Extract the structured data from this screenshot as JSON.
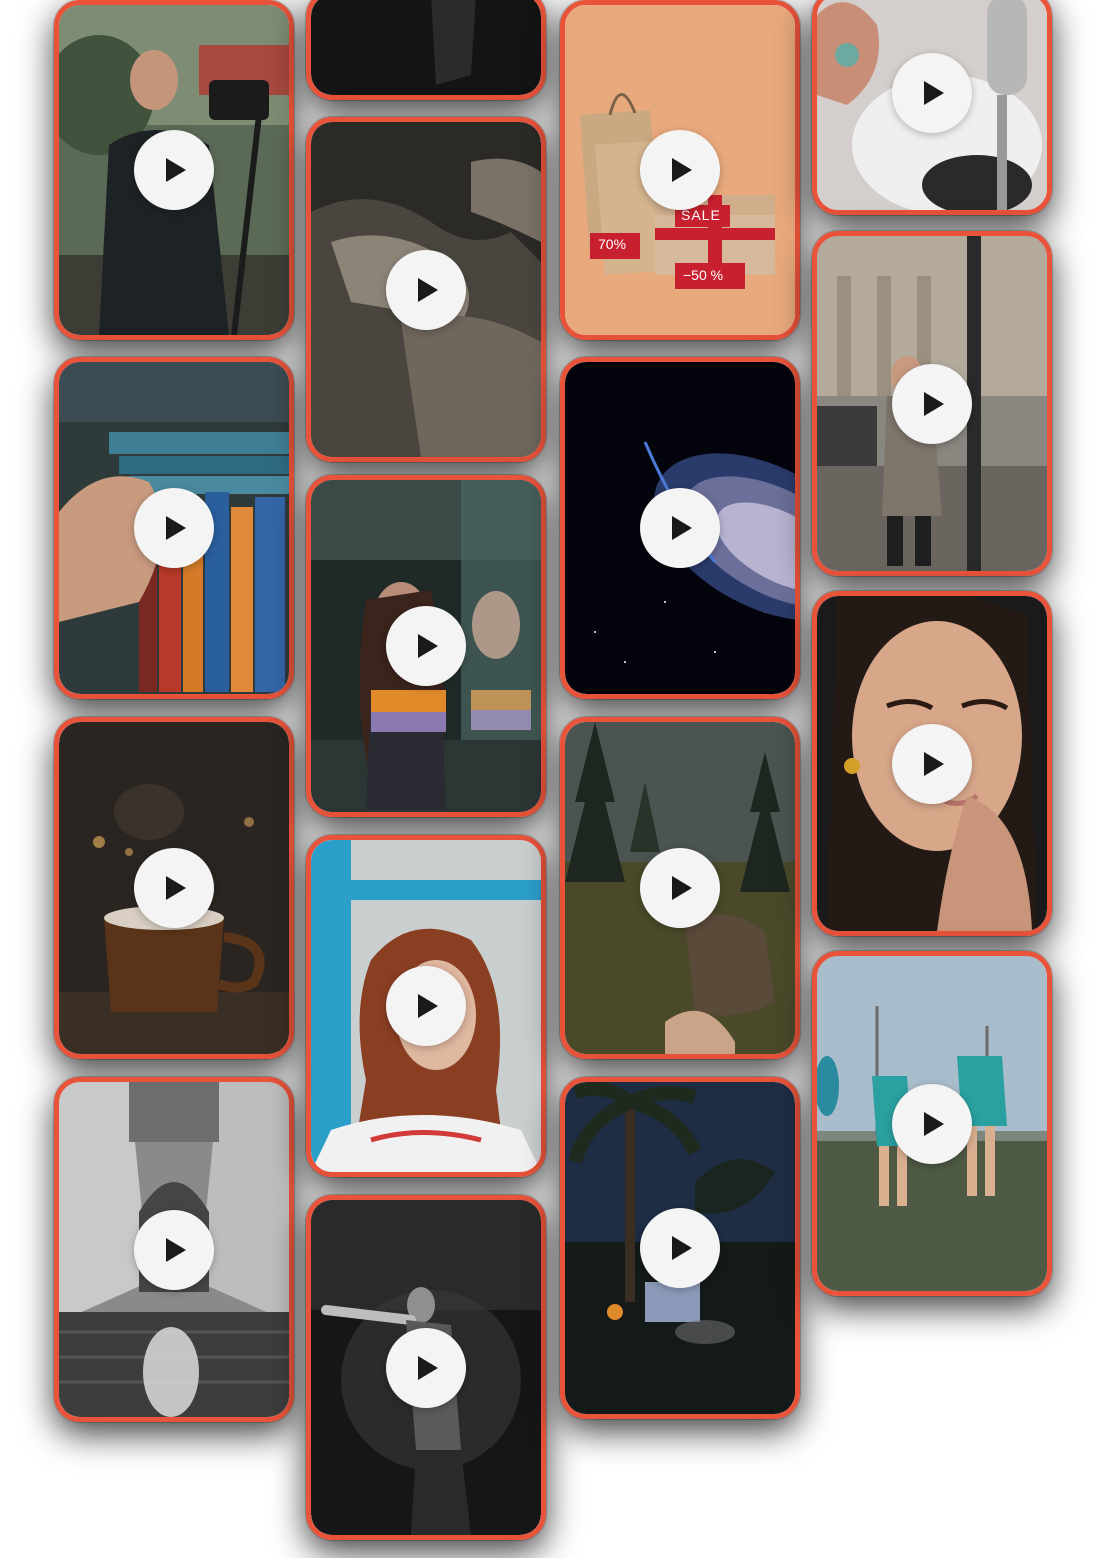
{
  "gallery": {
    "columns": [
      {
        "id": "col1",
        "cards": [
          {
            "name": "video-card-cameraman",
            "topic": "cameraman"
          },
          {
            "name": "video-card-books",
            "topic": "books"
          },
          {
            "name": "video-card-cocoa",
            "topic": "cocoa"
          },
          {
            "name": "video-card-architecture",
            "topic": "architecture"
          }
        ]
      },
      {
        "id": "col2",
        "cards": [
          {
            "name": "video-card-dark-figure",
            "topic": "dark-figure"
          },
          {
            "name": "video-card-hands",
            "topic": "hands"
          },
          {
            "name": "video-card-reflection",
            "topic": "reflection"
          },
          {
            "name": "video-card-portrait-redhead",
            "topic": "portrait-redhead"
          },
          {
            "name": "video-card-performer",
            "topic": "performer"
          }
        ]
      },
      {
        "id": "col3",
        "cards": [
          {
            "name": "video-card-sale",
            "topic": "sale",
            "tags": {
              "sale": "SALE",
              "seventy": "70%",
              "fifty": "−50 %"
            }
          },
          {
            "name": "video-card-space",
            "topic": "space"
          },
          {
            "name": "video-card-forest",
            "topic": "forest"
          },
          {
            "name": "video-card-campfire",
            "topic": "campfire"
          }
        ]
      },
      {
        "id": "col4",
        "cards": [
          {
            "name": "video-card-microphone",
            "topic": "microphone"
          },
          {
            "name": "video-card-street",
            "topic": "street"
          },
          {
            "name": "video-card-portrait",
            "topic": "portrait"
          },
          {
            "name": "video-card-football",
            "topic": "football"
          }
        ]
      }
    ],
    "accent_color": "#E8533A",
    "play_button_color": "#F4F4F4",
    "play_icon_color": "#1A1A1A",
    "icon": "play-icon"
  }
}
